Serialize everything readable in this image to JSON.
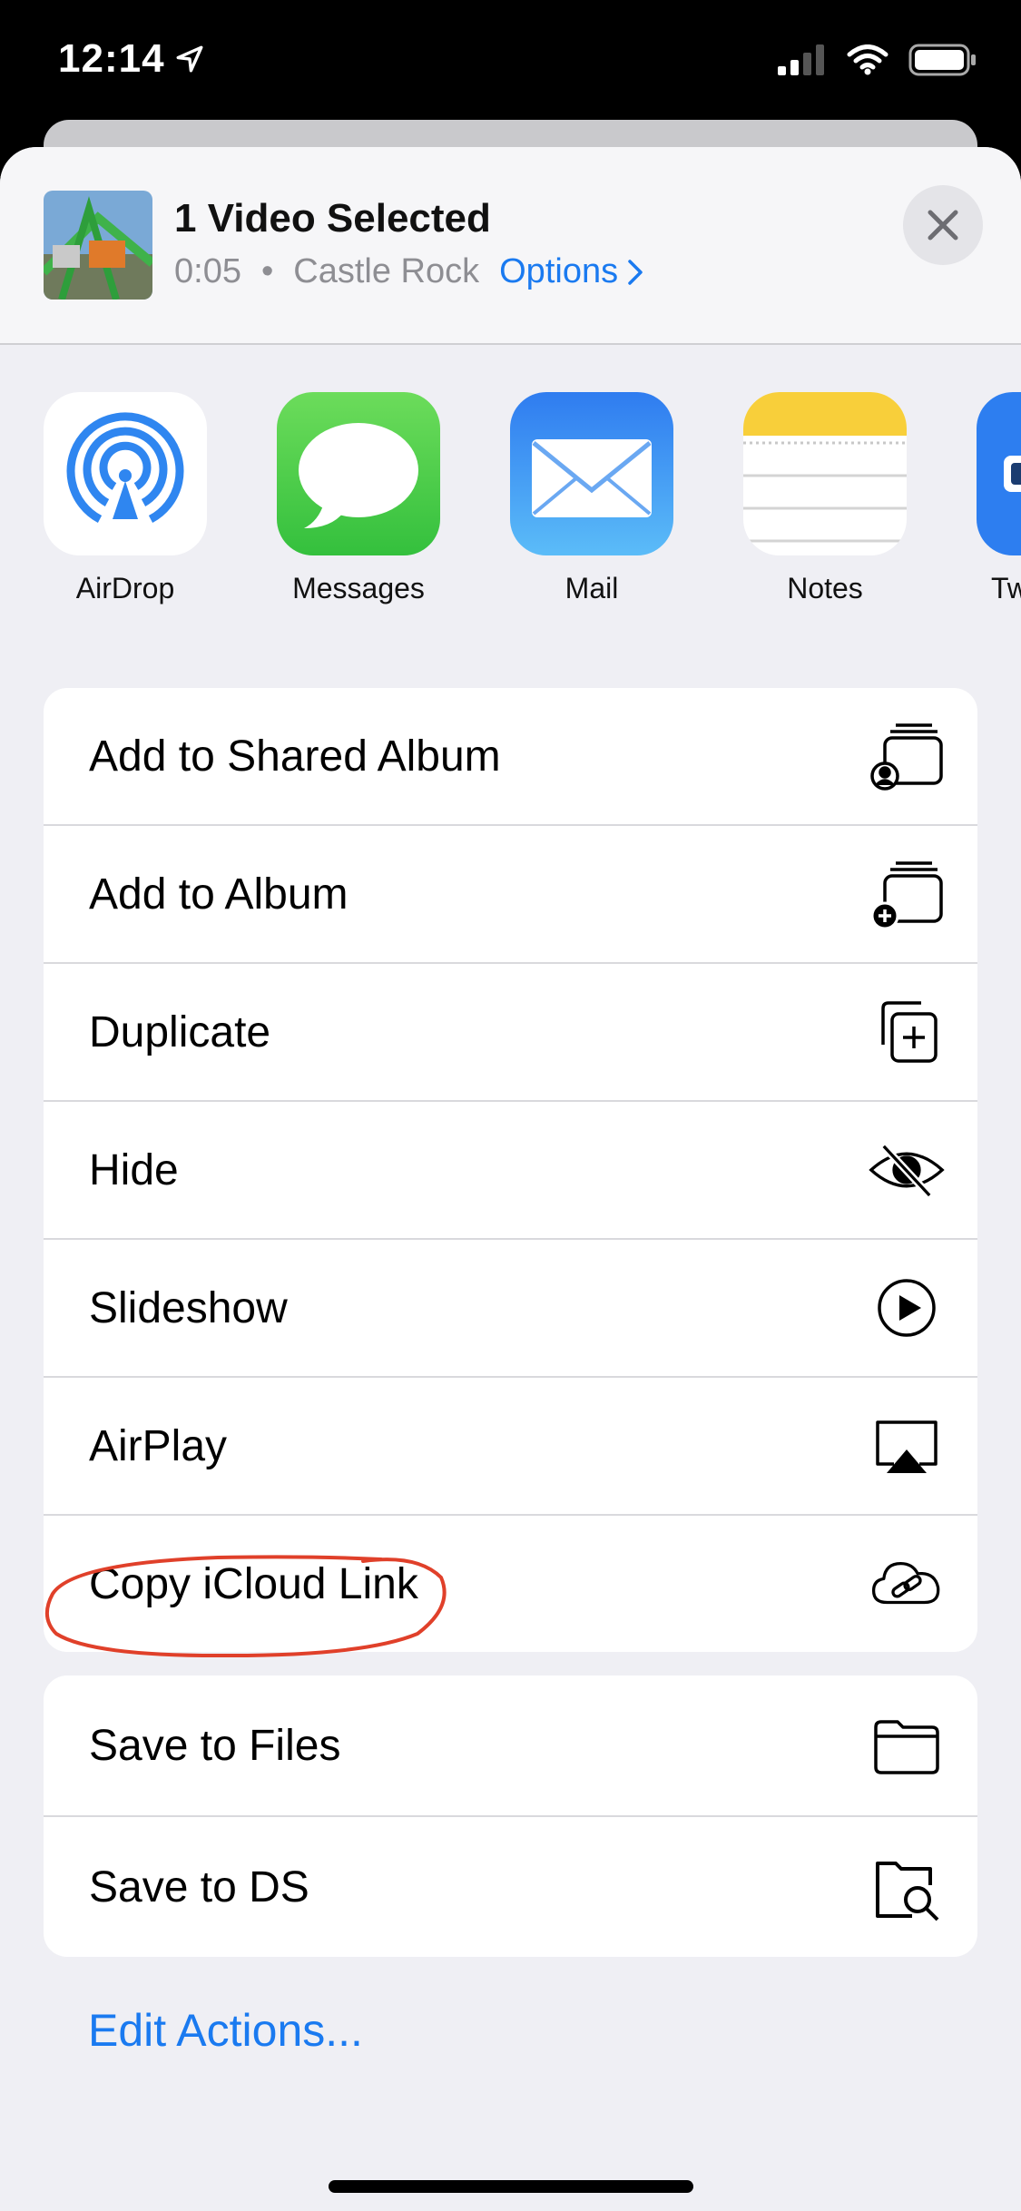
{
  "status_bar": {
    "time": "12:14"
  },
  "share_sheet": {
    "header": {
      "title": "1 Video Selected",
      "duration": "0:05",
      "separator": "•",
      "location": "Castle Rock",
      "options_label": "Options"
    },
    "apps": [
      {
        "label": "AirDrop",
        "icon": "airdrop-icon"
      },
      {
        "label": "Messages",
        "icon": "messages-icon"
      },
      {
        "label": "Mail",
        "icon": "mail-icon"
      },
      {
        "label": "Notes",
        "icon": "notes-icon"
      },
      {
        "label": "Tw",
        "icon": "partial-app-icon"
      }
    ],
    "actions_group1": [
      {
        "label": "Add to Shared Album",
        "icon": "shared-album-icon"
      },
      {
        "label": "Add to Album",
        "icon": "add-album-icon"
      },
      {
        "label": "Duplicate",
        "icon": "duplicate-icon"
      },
      {
        "label": "Hide",
        "icon": "hide-eye-icon"
      },
      {
        "label": "Slideshow",
        "icon": "play-circle-icon"
      },
      {
        "label": "AirPlay",
        "icon": "airplay-icon"
      },
      {
        "label": "Copy iCloud Link",
        "icon": "icloud-link-icon"
      }
    ],
    "actions_group2": [
      {
        "label": "Save to Files",
        "icon": "folder-icon"
      },
      {
        "label": "Save to DS",
        "icon": "ds-folder-search-icon"
      }
    ],
    "edit_actions_label": "Edit Actions..."
  },
  "colors": {
    "accent": "#1a7af0",
    "annotation": "#e0402a"
  }
}
